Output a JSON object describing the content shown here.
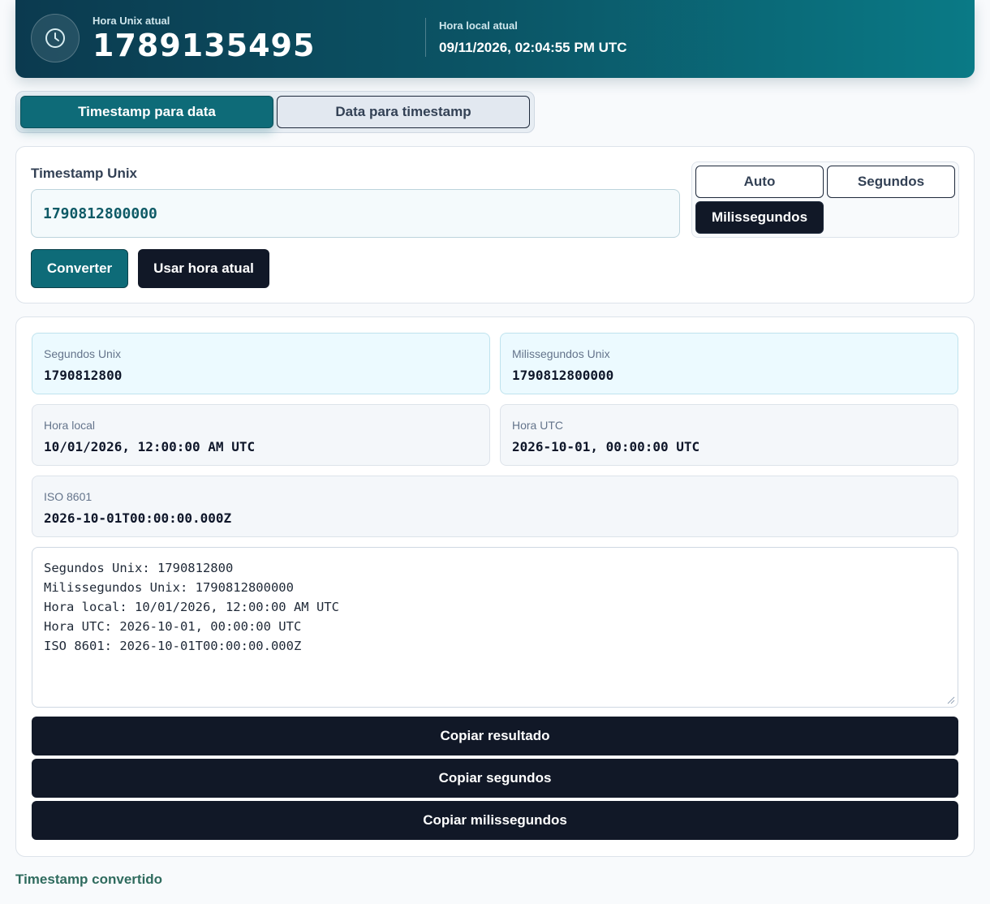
{
  "header": {
    "unix_label": "Hora Unix atual",
    "unix_value": "1789135495",
    "local_label": "Hora local atual",
    "local_value": "09/11/2026, 02:04:55 PM UTC",
    "icon": "clock-icon"
  },
  "tabs": [
    {
      "label": "Timestamp para data",
      "active": true
    },
    {
      "label": "Data para timestamp",
      "active": false
    }
  ],
  "input_section": {
    "label": "Timestamp Unix",
    "value": "1790812800000",
    "units": [
      {
        "label": "Auto",
        "active": false
      },
      {
        "label": "Segundos",
        "active": false
      },
      {
        "label": "Milissegundos",
        "active": true
      }
    ],
    "convert_label": "Converter",
    "now_label": "Usar hora atual"
  },
  "results": {
    "seconds": {
      "label": "Segundos Unix",
      "value": "1790812800"
    },
    "millis": {
      "label": "Milissegundos Unix",
      "value": "1790812800000"
    },
    "local": {
      "label": "Hora local",
      "value": "10/01/2026, 12:00:00 AM UTC"
    },
    "utc": {
      "label": "Hora UTC",
      "value": "2026-10-01, 00:00:00 UTC"
    },
    "iso": {
      "label": "ISO 8601",
      "value": "2026-10-01T00:00:00.000Z"
    },
    "summary_lines": [
      "Segundos Unix: 1790812800",
      "Milissegundos Unix: 1790812800000",
      "Hora local: 10/01/2026, 12:00:00 AM UTC",
      "Hora UTC: 2026-10-01, 00:00:00 UTC",
      "ISO 8601: 2026-10-01T00:00:00.000Z"
    ],
    "copy_result_label": "Copiar resultado",
    "copy_seconds_label": "Copiar segundos",
    "copy_millis_label": "Copiar milissegundos"
  },
  "footer": {
    "link_label": "Timestamp convertido"
  },
  "colors": {
    "accent": "#0e6b78",
    "dark": "#111827",
    "header_start": "#0b3a4f",
    "header_end": "#0a7a86"
  }
}
